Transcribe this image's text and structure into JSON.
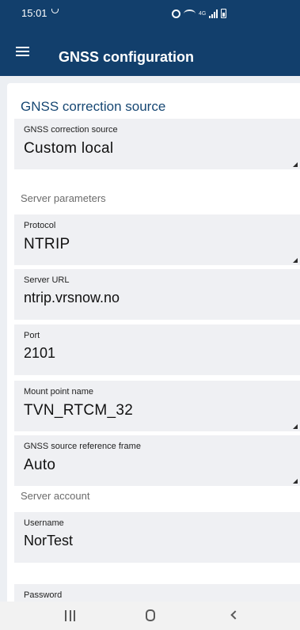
{
  "status_bar": {
    "time": "15:01",
    "network_label": "4G"
  },
  "app_bar": {
    "title": "GNSS configuration",
    "menu_icon": "hamburger-menu-icon"
  },
  "card": {
    "title": "GNSS correction source",
    "fields_top": [
      {
        "label": "GNSS correction source",
        "value": "Custom local",
        "dropdown": true
      }
    ],
    "section_server": "Server parameters",
    "server_fields": [
      {
        "label": "Protocol",
        "value": "NTRIP",
        "dropdown": true
      },
      {
        "label": "Server URL",
        "value": "ntrip.vrsnow.no",
        "dropdown": false
      },
      {
        "label": "Port",
        "value": "2101",
        "dropdown": false
      },
      {
        "label": "Mount point name",
        "value": "TVN_RTCM_32",
        "dropdown": true
      },
      {
        "label": "GNSS source reference frame",
        "value": "Auto",
        "dropdown": true
      }
    ],
    "section_account": "Server account",
    "account_fields": [
      {
        "label": "Username",
        "value": "NorTest",
        "dropdown": false
      },
      {
        "label": "Password",
        "value": "",
        "dropdown": false
      }
    ]
  },
  "colors": {
    "app_bar": "#123f6c",
    "content_bg": "#eceff3",
    "field_bg": "#eff0f3",
    "title_accent": "#164773"
  },
  "nav_bar": {
    "icons": [
      "recents-icon",
      "home-icon",
      "back-icon"
    ]
  }
}
